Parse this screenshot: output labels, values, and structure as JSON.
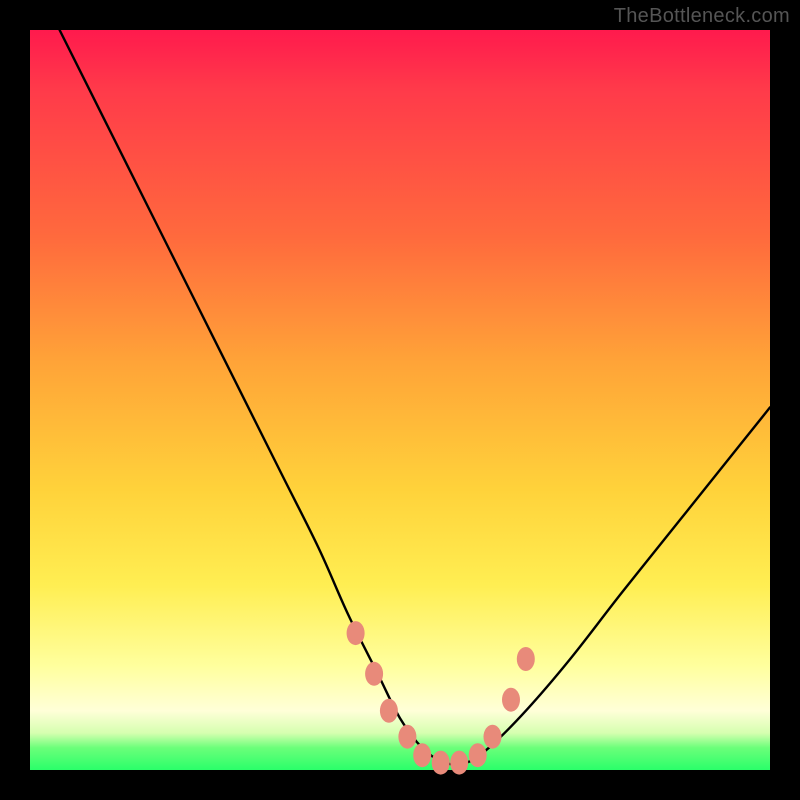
{
  "watermark": "TheBottleneck.com",
  "chart_data": {
    "type": "line",
    "title": "",
    "xlabel": "",
    "ylabel": "",
    "xlim": [
      0,
      100
    ],
    "ylim": [
      0,
      100
    ],
    "legend": false,
    "grid": false,
    "background_gradient": [
      "#ff1a4d",
      "#ff6a3d",
      "#ffd23a",
      "#ffff9e",
      "#2aff6a"
    ],
    "series": [
      {
        "name": "bottleneck-curve",
        "color": "#000000",
        "x": [
          4,
          10,
          16,
          22,
          28,
          34,
          39,
          43,
          47,
          50,
          53,
          56,
          59,
          62,
          67,
          73,
          80,
          88,
          96,
          100
        ],
        "y": [
          100,
          88,
          76,
          64,
          52,
          40,
          30,
          21,
          13,
          7,
          3,
          1,
          1,
          3,
          8,
          15,
          24,
          34,
          44,
          49
        ]
      }
    ],
    "markers": {
      "name": "highlight-dots",
      "color": "#e88a7a",
      "points": [
        {
          "x": 44.0,
          "y": 18.5
        },
        {
          "x": 46.5,
          "y": 13.0
        },
        {
          "x": 48.5,
          "y": 8.0
        },
        {
          "x": 51.0,
          "y": 4.5
        },
        {
          "x": 53.0,
          "y": 2.0
        },
        {
          "x": 55.5,
          "y": 1.0
        },
        {
          "x": 58.0,
          "y": 1.0
        },
        {
          "x": 60.5,
          "y": 2.0
        },
        {
          "x": 62.5,
          "y": 4.5
        },
        {
          "x": 65.0,
          "y": 9.5
        },
        {
          "x": 67.0,
          "y": 15.0
        }
      ]
    }
  }
}
